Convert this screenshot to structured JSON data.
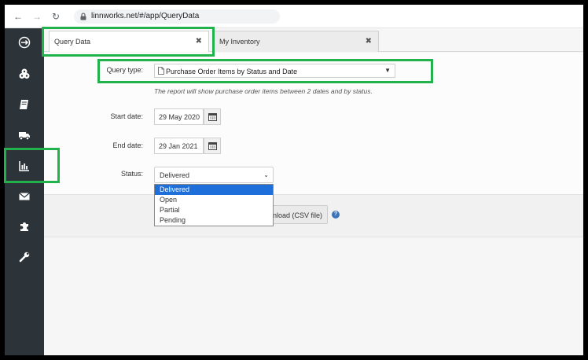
{
  "browser": {
    "url": "linnworks.net/#/app/QueryData"
  },
  "sidebar": {
    "items": [
      {
        "icon": "dashboard-icon"
      },
      {
        "icon": "inventory-icon"
      },
      {
        "icon": "book-icon"
      },
      {
        "icon": "truck-icon"
      },
      {
        "icon": "chart-icon"
      },
      {
        "icon": "envelope-icon"
      },
      {
        "icon": "puzzle-icon"
      },
      {
        "icon": "wrench-icon"
      }
    ]
  },
  "tabs": [
    {
      "label": "Query Data",
      "close": "✖"
    },
    {
      "label": "My Inventory",
      "close": "✖"
    }
  ],
  "form": {
    "query_type_label": "Query type:",
    "query_type_value": "Purchase Order Items by Status and Date",
    "help_text": "The report will show purchase order items between 2 dates and by status.",
    "start_date_label": "Start date:",
    "start_date_value": "29 May 2020",
    "end_date_label": "End date:",
    "end_date_value": "29 Jan 2021",
    "status_label": "Status:",
    "status_value": "Delivered",
    "status_options": [
      "Delivered",
      "Open",
      "Partial",
      "Pending"
    ]
  },
  "actions": {
    "download_label": "nload (CSV file)",
    "help_icon": "?"
  },
  "colors": {
    "highlight": "#21b24b",
    "sidebar": "#2c3439",
    "selected_option": "#1e6fd9"
  }
}
